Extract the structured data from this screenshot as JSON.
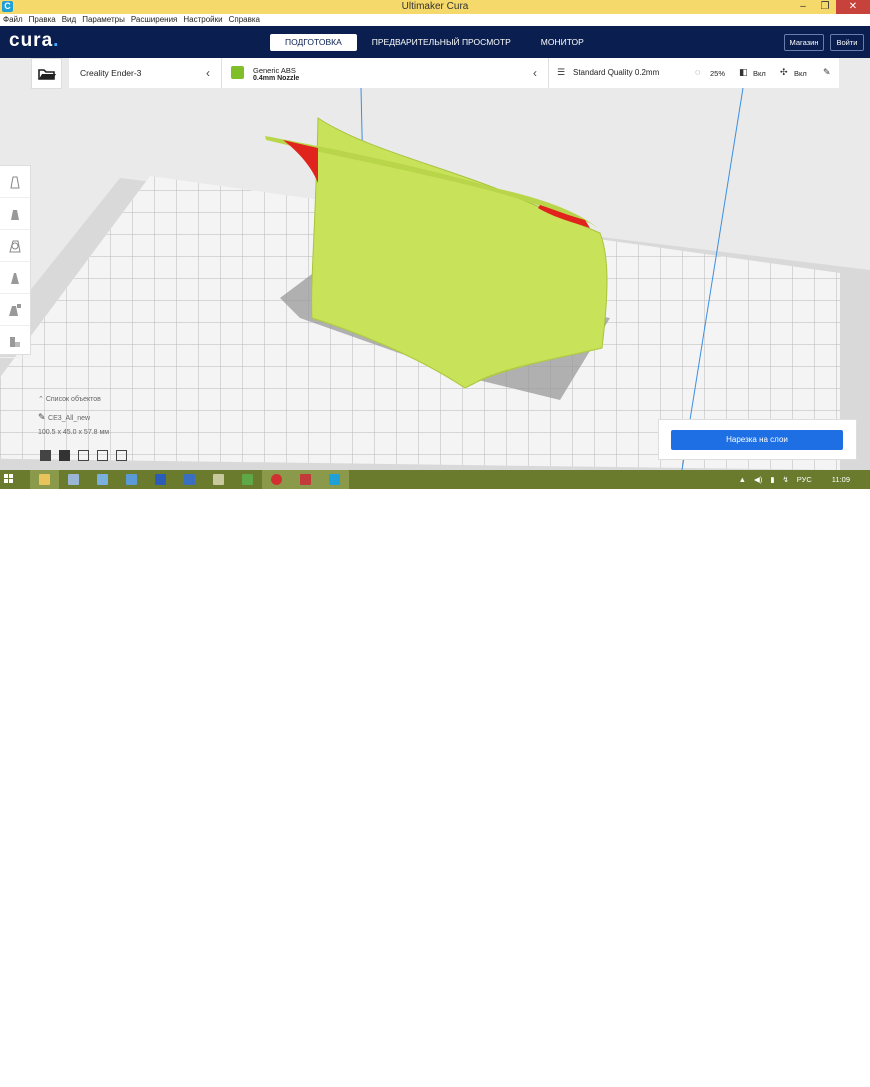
{
  "window": {
    "title": "Ultimaker Cura",
    "icon_letter": "C",
    "minimize": "–",
    "restore": "❐",
    "close": "✕"
  },
  "menu": [
    "Файл",
    "Правка",
    "Вид",
    "Параметры",
    "Расширения",
    "Настройки",
    "Справка"
  ],
  "header": {
    "logo": "cura",
    "tabs": [
      {
        "label": "ПОДГОТОВКА",
        "active": true
      },
      {
        "label": "ПРЕДВАРИТЕЛЬНЫЙ ПРОСМОТР",
        "active": false
      },
      {
        "label": "МОНИТОР",
        "active": false
      }
    ],
    "store_button": "Магазин",
    "login_button": "Войти"
  },
  "printer": {
    "name": "Creality Ender-3"
  },
  "material": {
    "name": "Generic ABS",
    "nozzle": "0.4mm Nozzle",
    "color": "#7fbf2a"
  },
  "print_settings": {
    "profile": "Standard Quality 0.2mm",
    "infill": "25%",
    "support": "Вкл",
    "adhesion": "Вкл"
  },
  "left_tools": [
    "move-tool",
    "scale-tool",
    "rotate-tool",
    "mirror-tool",
    "per-model-settings-tool",
    "support-blocker-tool"
  ],
  "object_info": {
    "list_label": "Список объектов",
    "name": "CE3_All_new",
    "dimensions": "100.5 x 45.0 x 57.8 мм"
  },
  "slice": {
    "button": "Нарезка на слои",
    "accent": "#1e6fe3"
  },
  "model": {
    "color": "#c8e35a",
    "overhang_color": "#e0231c"
  },
  "taskbar": {
    "apps": [
      {
        "name": "explorer",
        "color": "#e8c45a"
      },
      {
        "name": "network",
        "color": "#9ab5d6"
      },
      {
        "name": "notes",
        "color": "#7ab0e0"
      },
      {
        "name": "files",
        "color": "#5a9ad6"
      },
      {
        "name": "word",
        "color": "#2b5cb8"
      },
      {
        "name": "visio",
        "color": "#3a6ec0"
      },
      {
        "name": "paint",
        "color": "#c9c9a0"
      },
      {
        "name": "tree-app",
        "color": "#5fa84a"
      },
      {
        "name": "opera",
        "color": "#d23030"
      },
      {
        "name": "docs",
        "color": "#c23a3a"
      },
      {
        "name": "cura",
        "color": "#1fa0d6"
      }
    ],
    "language": "РУС",
    "time": "11:09"
  }
}
